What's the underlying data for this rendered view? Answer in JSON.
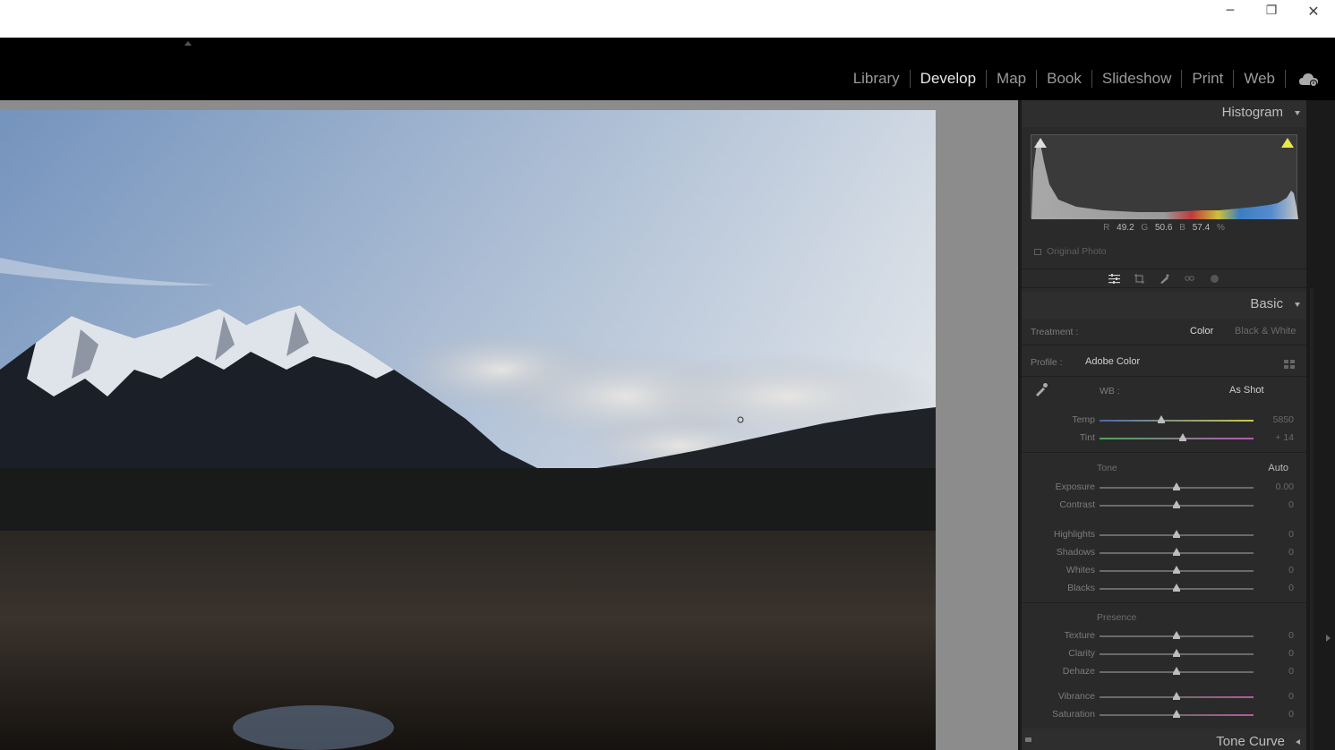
{
  "window": {
    "minimize_glyph": "─",
    "maximize_glyph": "❐",
    "close_glyph": "✕"
  },
  "modules": [
    {
      "label": "Library",
      "active": false
    },
    {
      "label": "Develop",
      "active": true
    },
    {
      "label": "Map",
      "active": false
    },
    {
      "label": "Book",
      "active": false
    },
    {
      "label": "Slideshow",
      "active": false
    },
    {
      "label": "Print",
      "active": false
    },
    {
      "label": "Web",
      "active": false
    }
  ],
  "icons": {
    "cloud": "cloud-sync-icon",
    "tools": [
      "edit-sliders-icon",
      "crop-icon",
      "healing-brush-icon",
      "red-eye-icon",
      "masking-icon"
    ]
  },
  "histogram": {
    "title": "Histogram",
    "r_label": "R",
    "r_value": "49.2",
    "g_label": "G",
    "g_value": "50.6",
    "b_label": "B",
    "b_value": "57.4",
    "unit": "%",
    "original_photo_label": "Original Photo"
  },
  "basic": {
    "title": "Basic",
    "treatment_label": "Treatment :",
    "treatment_color": "Color",
    "treatment_bw": "Black & White",
    "profile_label": "Profile :",
    "profile_value": "Adobe Color",
    "wb_label": "WB :",
    "wb_value": "As Shot",
    "tone_label": "Tone",
    "auto_label": "Auto",
    "presence_label": "Presence",
    "sliders": {
      "temp": {
        "label": "Temp",
        "value": "5850",
        "position": 0.4
      },
      "tint": {
        "label": "Tint",
        "value": "+ 14",
        "position": 0.54
      },
      "exposure": {
        "label": "Exposure",
        "value": "0.00",
        "position": 0.5
      },
      "contrast": {
        "label": "Contrast",
        "value": "0",
        "position": 0.5
      },
      "highlights": {
        "label": "Highlights",
        "value": "0",
        "position": 0.5
      },
      "shadows": {
        "label": "Shadows",
        "value": "0",
        "position": 0.5
      },
      "whites": {
        "label": "Whites",
        "value": "0",
        "position": 0.5
      },
      "blacks": {
        "label": "Blacks",
        "value": "0",
        "position": 0.5
      },
      "texture": {
        "label": "Texture",
        "value": "0",
        "position": 0.5
      },
      "clarity": {
        "label": "Clarity",
        "value": "0",
        "position": 0.5
      },
      "dehaze": {
        "label": "Dehaze",
        "value": "0",
        "position": 0.5
      },
      "vibrance": {
        "label": "Vibrance",
        "value": "0",
        "position": 0.5
      },
      "saturation": {
        "label": "Saturation",
        "value": "0",
        "position": 0.5
      }
    }
  },
  "tone_curve": {
    "title": "Tone Curve"
  },
  "colors": {
    "accent_highlight_clip": "#e8e84a",
    "panel_bg": "#2a2a2a",
    "active_module": "#e8e8e8",
    "inactive_module": "#9a9a9a"
  }
}
